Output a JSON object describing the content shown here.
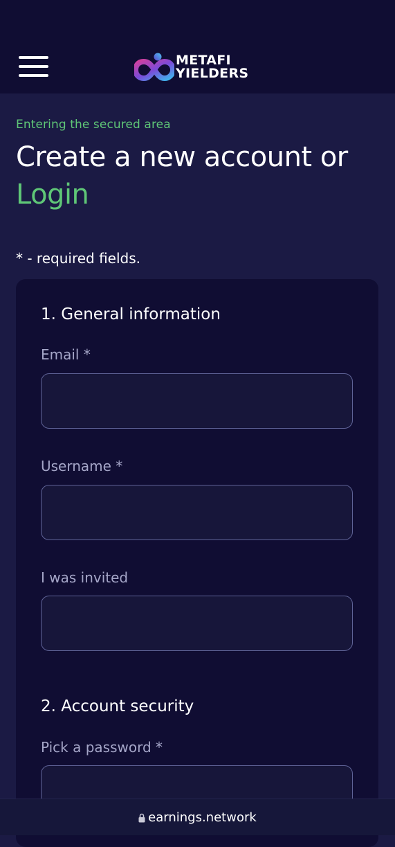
{
  "header": {
    "logo_line1": "METAFI",
    "logo_line2": "YIELDERS",
    "menu_icon": "hamburger-menu-icon"
  },
  "intro": {
    "eyebrow": "Entering the secured area",
    "title_main": "Create a new account or",
    "title_link": "Login",
    "required_note": "* - required fields."
  },
  "form": {
    "section1_title": "1. General information",
    "email_label": "Email *",
    "email_value": "",
    "username_label": "Username *",
    "username_value": "",
    "invited_label": "I was invited",
    "invited_value": "",
    "section2_title": "2. Account security",
    "password_label": "Pick a password *",
    "password_value": ""
  },
  "browser": {
    "url": "earnings.network",
    "lock_icon": "lock-icon"
  },
  "colors": {
    "background": "#1b1a44",
    "header": "#100d33",
    "accent_green": "#5fc777",
    "input_border": "#5f6397",
    "label": "#a5a6c8"
  }
}
